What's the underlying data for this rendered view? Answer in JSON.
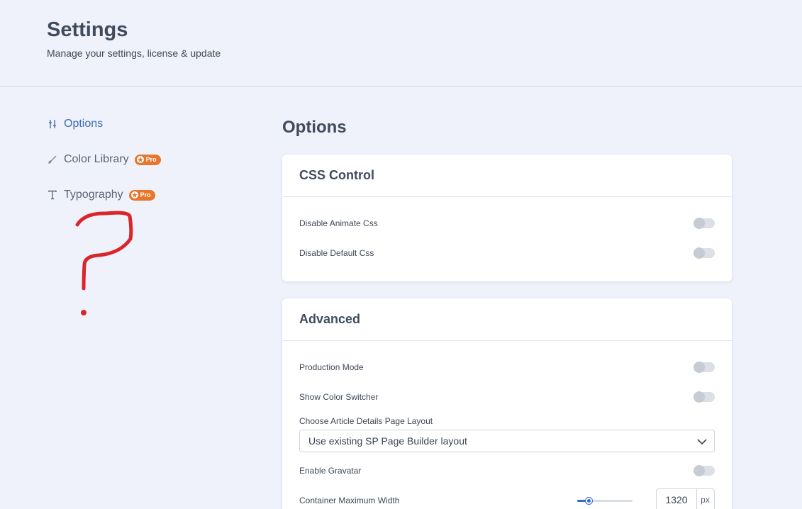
{
  "header": {
    "title": "Settings",
    "subtitle": "Manage your settings, license & update"
  },
  "sidebar": {
    "items": [
      {
        "label": "Options",
        "icon": "sliders-icon",
        "active": true
      },
      {
        "label": "Color Library",
        "icon": "brush-icon",
        "badge": "Pro"
      },
      {
        "label": "Typography",
        "icon": "text-icon",
        "badge": "Pro"
      }
    ]
  },
  "main": {
    "title": "Options",
    "css_control": {
      "title": "CSS Control",
      "rows": [
        {
          "label": "Disable Animate Css",
          "enabled": false
        },
        {
          "label": "Disable Default Css",
          "enabled": false
        }
      ]
    },
    "advanced": {
      "title": "Advanced",
      "production_mode": {
        "label": "Production Mode",
        "enabled": false
      },
      "color_switcher": {
        "label": "Show Color Switcher",
        "enabled": false
      },
      "layout_select": {
        "label": "Choose Article Details Page Layout",
        "value": "Use existing SP Page Builder layout"
      },
      "gravatar": {
        "label": "Enable Gravatar",
        "enabled": false
      },
      "container_width": {
        "label": "Container Maximum Width",
        "value": "1320",
        "unit": "px",
        "slider_fraction": 0.22
      }
    }
  },
  "colors": {
    "accent": "#3d6bb7",
    "pro_badge": "#e8752a",
    "annotation": "#d9262b"
  }
}
